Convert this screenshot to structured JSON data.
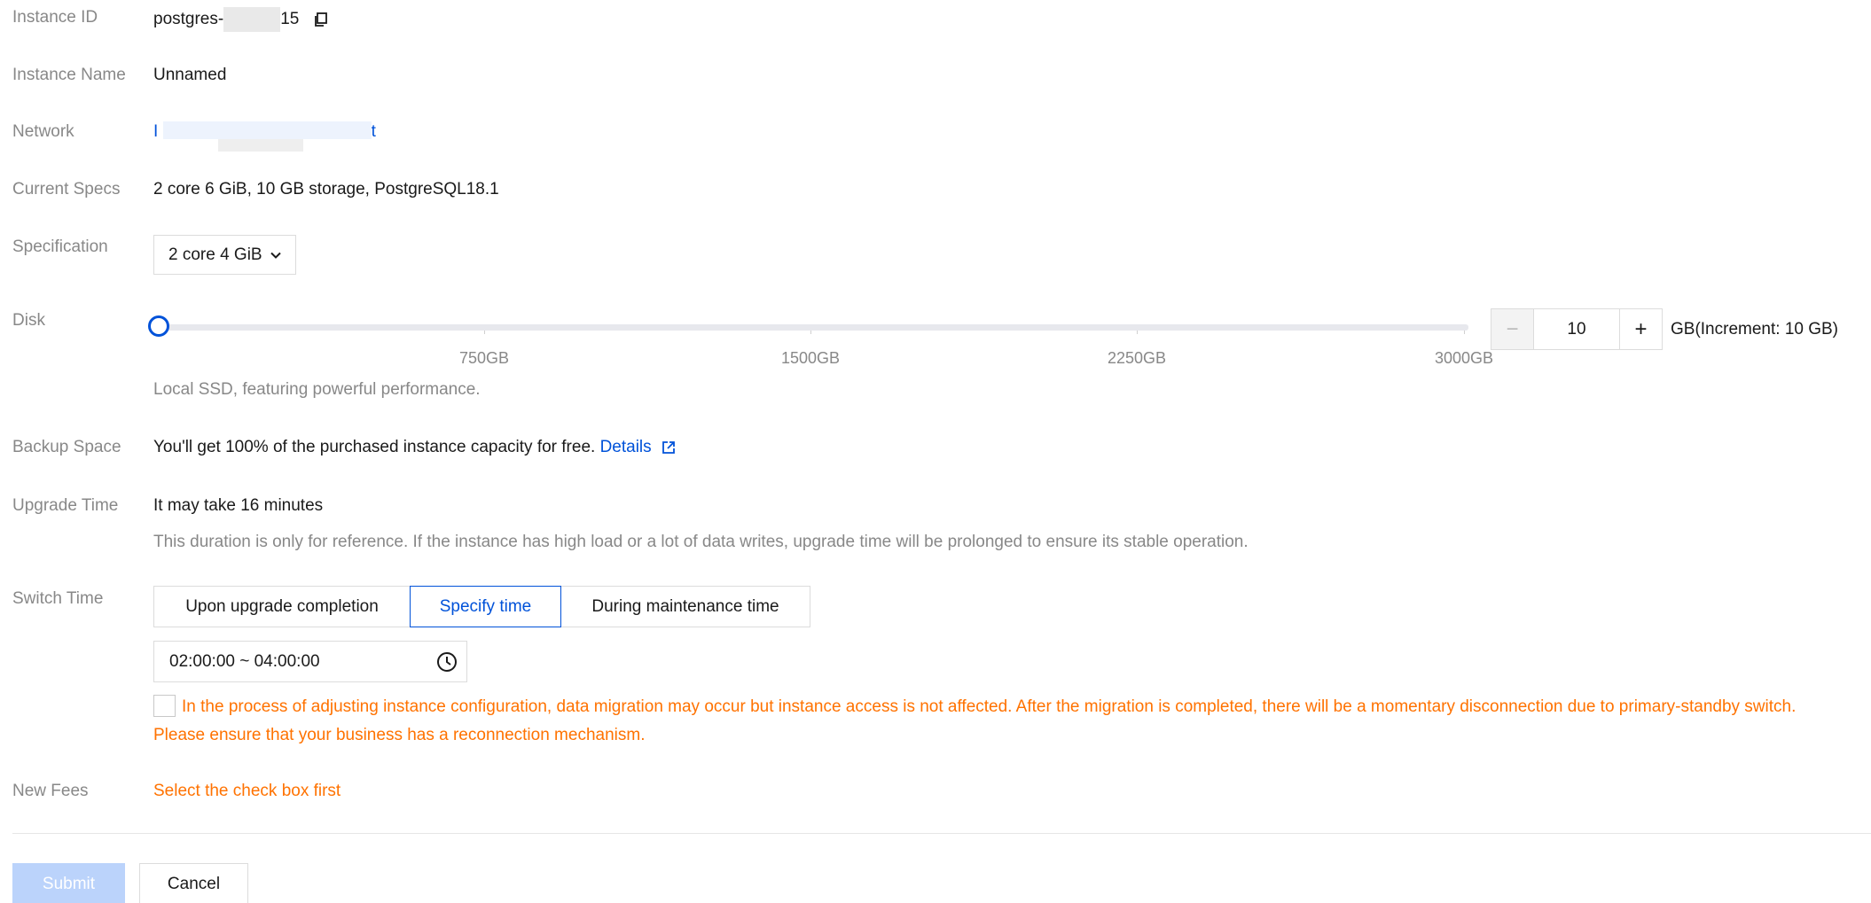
{
  "instance_id": {
    "label": "Instance ID",
    "prefix": "postgres-",
    "suffix": "15",
    "copy_icon": "copy-icon"
  },
  "instance_name": {
    "label": "Instance Name",
    "value": "Unnamed"
  },
  "network": {
    "label": "Network",
    "prefix": "I",
    "suffix": "t"
  },
  "current_specs": {
    "label": "Current Specs",
    "value": "2 core 6 GiB, 10 GB storage, PostgreSQL18.1"
  },
  "specification": {
    "label": "Specification",
    "selected": "2 core 4 GiB",
    "icon": "chevron-down-icon"
  },
  "disk": {
    "label": "Disk",
    "ticks": [
      "750GB",
      "1500GB",
      "2250GB",
      "3000GB"
    ],
    "value": "10",
    "minus": "−",
    "plus": "+",
    "unit": "GB(Increment: 10 GB)",
    "note": "Local SSD, featuring powerful performance."
  },
  "backup_space": {
    "label": "Backup Space",
    "text": "You'll get 100% of the purchased instance capacity for free.",
    "link": "Details",
    "icon": "external-link-icon"
  },
  "upgrade_time": {
    "label": "Upgrade Time",
    "value": "It may take 16 minutes",
    "note": "This duration is only for reference. If the instance has high load or a lot of data writes, upgrade time will be prolonged to ensure its stable operation."
  },
  "switch_time": {
    "label": "Switch Time",
    "options": [
      "Upon upgrade completion",
      "Specify time",
      "During maintenance time"
    ],
    "selected_index": 1,
    "time_range": "02:00:00 ~ 04:00:00",
    "icon": "clock-icon"
  },
  "notice": "In the process of adjusting instance configuration, data migration may occur but instance access is not affected. After the migration is completed, there will be a momentary disconnection due to primary-standby switch. Please ensure that your business has a reconnection mechanism.",
  "new_fees": {
    "label": "New Fees",
    "value": "Select the check box first"
  },
  "actions": {
    "submit": "Submit",
    "cancel": "Cancel"
  },
  "colors": {
    "accent": "#0052d9",
    "warning": "#ff7200",
    "muted": "#888888",
    "submit_disabled": "#bbd3fb"
  }
}
